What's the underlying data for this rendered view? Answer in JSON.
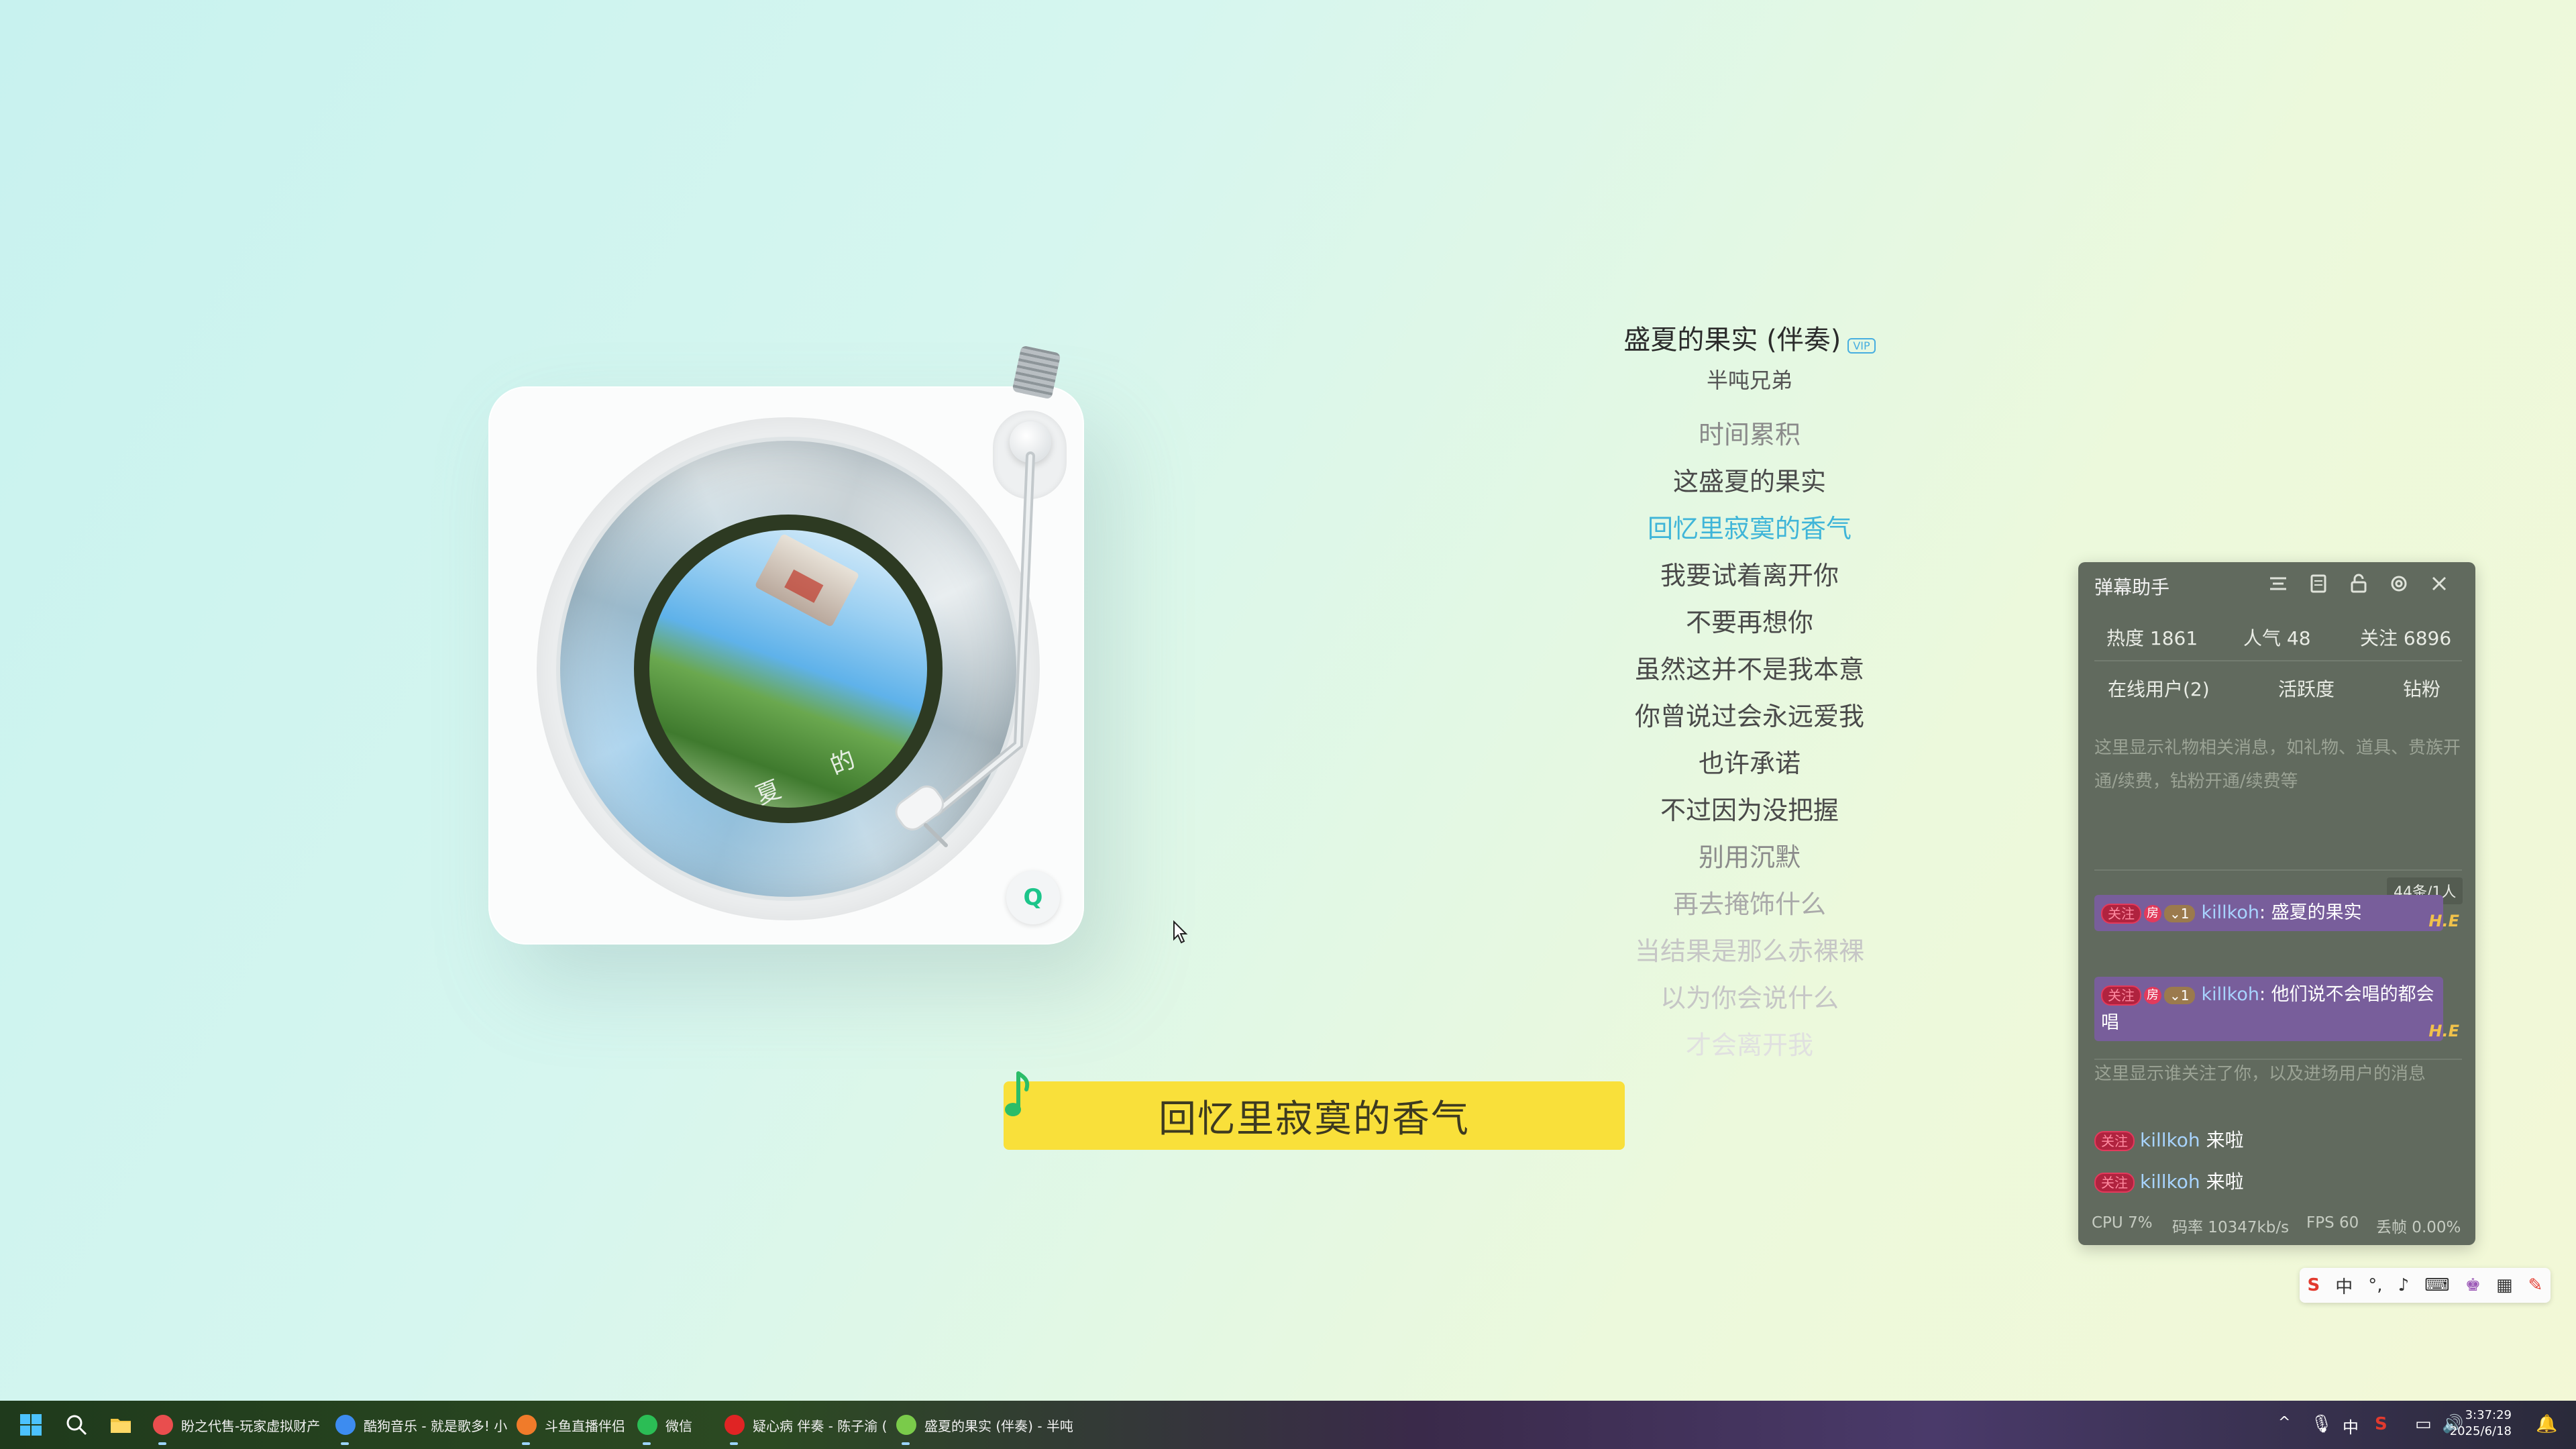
{
  "song": {
    "title": "盛夏的果实 (伴奏)",
    "vip_badge": "VIP",
    "artist": "半吨兄弟"
  },
  "lyrics": [
    {
      "text": "时间累积",
      "state": "past"
    },
    {
      "text": "这盛夏的果实",
      "state": "normal"
    },
    {
      "text": "回忆里寂寞的香气",
      "state": "active"
    },
    {
      "text": "我要试着离开你",
      "state": "normal"
    },
    {
      "text": "不要再想你",
      "state": "normal"
    },
    {
      "text": "虽然这并不是我本意",
      "state": "normal"
    },
    {
      "text": "你曾说过会永远爱我",
      "state": "normal"
    },
    {
      "text": "也许承诺",
      "state": "normal"
    },
    {
      "text": "不过因为没把握",
      "state": "normal"
    },
    {
      "text": "别用沉默",
      "state": "fade1"
    },
    {
      "text": "再去掩饰什么",
      "state": "fade2"
    },
    {
      "text": "当结果是那么赤裸裸",
      "state": "fade3"
    },
    {
      "text": "以为你会说什么",
      "state": "fade3"
    },
    {
      "text": "才会离开我",
      "state": "fade4"
    }
  ],
  "banner": {
    "current_lyric": "回忆里寂寞的香气"
  },
  "cover": {
    "text": "夏 的 果"
  },
  "danmaku": {
    "title": "弹幕助手",
    "stats": {
      "heat": "热度 1861",
      "popularity": "人气 48",
      "follows": "关注 6896"
    },
    "tabs": [
      "在线用户(2)",
      "活跃度",
      "钻粉"
    ],
    "gift_placeholder": "这里显示礼物相关消息，如礼物、道具、贵族开通/续费，钻粉开通/续费等",
    "message_count": "44条/1人",
    "messages": [
      {
        "badge": "关注",
        "room": "房",
        "level": "1",
        "user": "killkoh",
        "text": ": 盛夏的果实"
      },
      {
        "badge": "关注",
        "room": "房",
        "level": "1",
        "user": "killkoh",
        "text": ": 他们说不会唱的都会唱"
      }
    ],
    "he_mark": "H.E",
    "follow_placeholder": "这里显示谁关注了你，以及进场用户的消息",
    "enters": [
      {
        "badge": "关注",
        "user": "killkoh",
        "text": "来啦"
      },
      {
        "badge": "关注",
        "user": "killkoh",
        "text": "来啦"
      }
    ],
    "status": {
      "cpu": "CPU 7%",
      "bitrate": "码率 10347kb/s",
      "fps": "FPS 60",
      "drop": "丢帧 0.00%"
    }
  },
  "ime": {
    "items": [
      "S",
      "中",
      "°,",
      "♪",
      "⌨",
      "♚",
      "▦",
      "✎"
    ]
  },
  "taskbar": {
    "apps": [
      {
        "label": "盼之代售-玩家虚拟财产",
        "color": "#e94e4e"
      },
      {
        "label": "酷狗音乐 - 就是歌多! 小",
        "color": "#3d8cf0"
      },
      {
        "label": "斗鱼直播伴侣",
        "color": "#f07b2a"
      },
      {
        "label": "微信",
        "color": "#2bbd55"
      },
      {
        "label": "疑心病 伴奏 - 陈子渝 (",
        "color": "#e02424"
      },
      {
        "label": "盛夏的果实 (伴奏) - 半吨",
        "color": "#7acb4a"
      }
    ],
    "tray_ime": "中",
    "time": "3:37:29",
    "date": "2025/6/18"
  },
  "colors": {
    "accent_lyric": "#3fb5d8",
    "banner": "#f9e03a",
    "panel_bg": "#616a5e"
  }
}
